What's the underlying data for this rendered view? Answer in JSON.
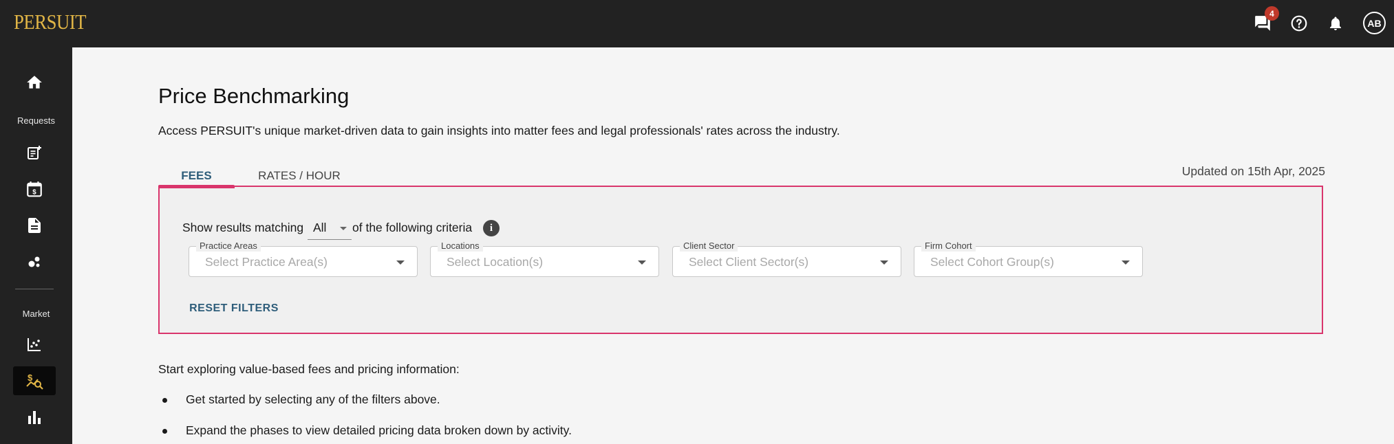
{
  "app": {
    "logo": "PERSUIT",
    "notification_count": "4",
    "user_initials": "AB"
  },
  "topbar": {
    "icons": [
      "chat-icon",
      "help-icon",
      "bell-icon",
      "avatar"
    ]
  },
  "sidebar": {
    "sections": {
      "requests": "Requests",
      "market": "Market"
    },
    "items": [
      {
        "name": "home",
        "icon": "home-icon"
      },
      {
        "name": "new-request",
        "icon": "request-add-icon"
      },
      {
        "name": "calendar-pricing",
        "icon": "calendar-dollar-icon"
      },
      {
        "name": "documents",
        "icon": "document-icon"
      },
      {
        "name": "network",
        "icon": "network-icon"
      },
      {
        "name": "market-scatter",
        "icon": "scatter-chart-icon"
      },
      {
        "name": "price-benchmarking",
        "icon": "price-search-icon",
        "active": true
      },
      {
        "name": "bar-chart",
        "icon": "bar-chart-icon"
      }
    ],
    "active_color": "#e2b646"
  },
  "page": {
    "title": "Price Benchmarking",
    "description": "Access PERSUIT's unique market-driven data to gain insights into matter fees and legal professionals' rates across the industry."
  },
  "tabs": [
    {
      "label": "FEES",
      "active": true
    },
    {
      "label": "RATES / HOUR",
      "active": false
    }
  ],
  "updated": "Updated on 15th Apr, 2025",
  "filters": {
    "match_prefix": "Show results matching",
    "match_value": "All",
    "match_suffix": "of the following criteria",
    "fields": [
      {
        "label": "Practice Areas",
        "placeholder": "Select Practice Area(s)"
      },
      {
        "label": "Locations",
        "placeholder": "Select Location(s)"
      },
      {
        "label": "Client Sector",
        "placeholder": "Select Client Sector(s)"
      },
      {
        "label": "Firm Cohort",
        "placeholder": "Select Cohort Group(s)"
      }
    ],
    "reset_label": "RESET FILTERS"
  },
  "explore": {
    "intro": "Start exploring value-based fees and pricing information:",
    "bullets": [
      "Get started by selecting any of the filters above.",
      "Expand the phases to view detailed pricing data broken down by activity."
    ]
  },
  "colors": {
    "topbar": "#222222",
    "accent_pink": "#d9356c",
    "link_blue": "#2e5d7a",
    "logo_gold": "#e2b646",
    "badge_red": "#c0392b"
  }
}
